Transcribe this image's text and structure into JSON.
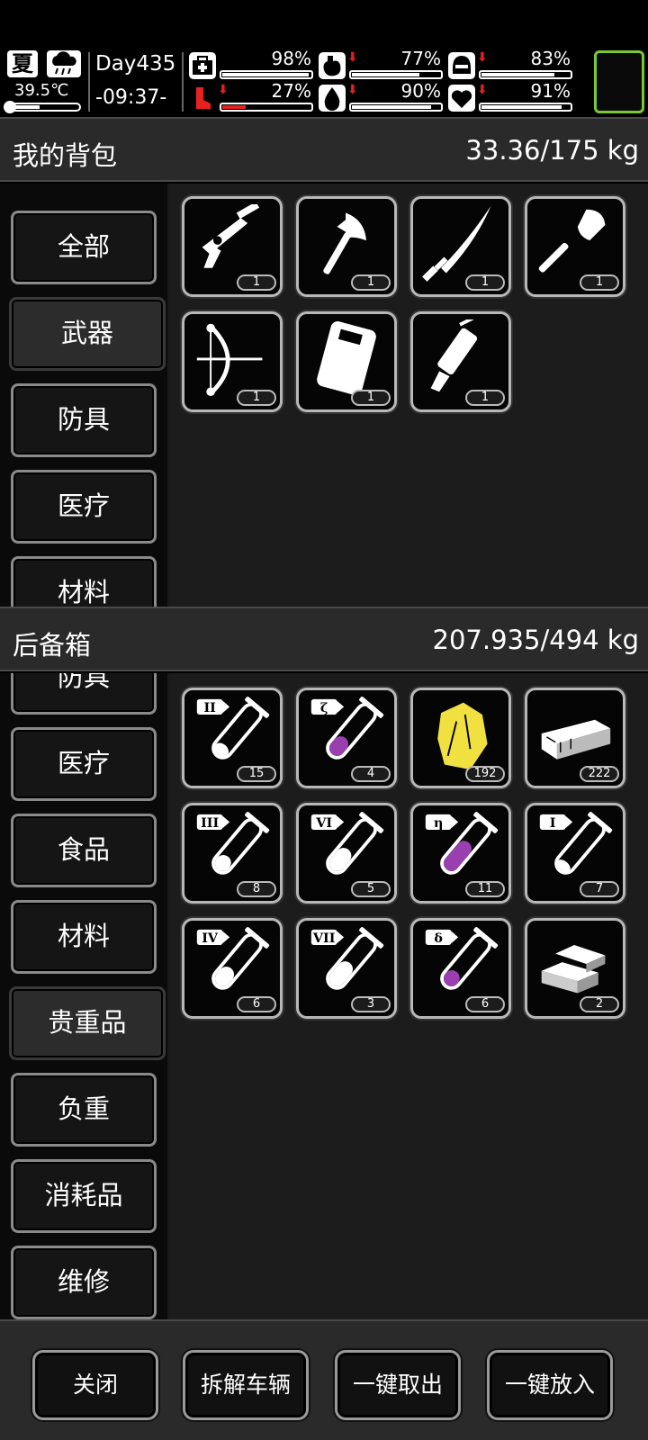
{
  "hud": {
    "season": "夏",
    "temperature": "39.5℃",
    "temperature_level": 0.45,
    "day": "Day435",
    "time": "-09:37-",
    "stats": [
      {
        "name": "health",
        "icon": "medkit-icon",
        "value": "98%",
        "level": 0.98,
        "arrow": false
      },
      {
        "name": "hunger",
        "icon": "stomach-icon",
        "value": "77%",
        "level": 0.77,
        "arrow": true
      },
      {
        "name": "armor",
        "icon": "helmet-icon",
        "value": "83%",
        "level": 0.83,
        "arrow": true
      },
      {
        "name": "stamina",
        "icon": "leg-icon",
        "value": "27%",
        "level": 0.27,
        "arrow": true,
        "color": "#e82020"
      },
      {
        "name": "thirst",
        "icon": "water-drop-icon",
        "value": "90%",
        "level": 0.9,
        "arrow": true
      },
      {
        "name": "mood",
        "icon": "heart-icon",
        "value": "91%",
        "level": 0.91,
        "arrow": true
      }
    ]
  },
  "backpack": {
    "title": "我的背包",
    "weight": "33.36/175 kg",
    "categories": [
      "全部",
      "武器",
      "防具",
      "医疗",
      "材料"
    ],
    "active_category": "武器",
    "items": [
      {
        "icon": "nail-gun-icon",
        "count": "1"
      },
      {
        "icon": "axe-icon",
        "count": "1"
      },
      {
        "icon": "katana-icon",
        "count": "1"
      },
      {
        "icon": "shovel-icon",
        "count": "1"
      },
      {
        "icon": "compound-bow-icon",
        "count": "1"
      },
      {
        "icon": "riot-shield-icon",
        "count": "1"
      },
      {
        "icon": "minigun-icon",
        "count": "1"
      }
    ]
  },
  "trunk": {
    "title": "后备箱",
    "weight": "207.935/494 kg",
    "categories": [
      "防具",
      "医疗",
      "食品",
      "材料",
      "贵重品",
      "负重",
      "消耗品",
      "维修"
    ],
    "active_category": "贵重品",
    "items": [
      {
        "icon": "test-tube-icon",
        "label": "II",
        "count": "15",
        "liquid": "#ffffff",
        "fill": 0.25
      },
      {
        "icon": "test-tube-icon",
        "label": "ζ",
        "count": "4",
        "liquid": "#9a3fb0",
        "fill": 0.45
      },
      {
        "icon": "gold-nugget-icon",
        "count": "192",
        "color": "#f0e040"
      },
      {
        "icon": "cash-stack-icon",
        "count": "222"
      },
      {
        "icon": "test-tube-icon",
        "label": "III",
        "count": "8",
        "liquid": "#ffffff",
        "fill": 0.35
      },
      {
        "icon": "test-tube-icon",
        "label": "VI",
        "count": "5",
        "liquid": "#ffffff",
        "fill": 0.55
      },
      {
        "icon": "test-tube-icon",
        "label": "η",
        "count": "11",
        "liquid": "#9a3fb0",
        "fill": 0.75
      },
      {
        "icon": "test-tube-icon",
        "label": "I",
        "count": "7",
        "liquid": "#ffffff",
        "fill": 0.2
      },
      {
        "icon": "test-tube-icon",
        "label": "IV",
        "count": "6",
        "liquid": "#ffffff",
        "fill": 0.45
      },
      {
        "icon": "test-tube-icon",
        "label": "VII",
        "count": "3",
        "liquid": "#ffffff",
        "fill": 0.6
      },
      {
        "icon": "test-tube-icon",
        "label": "δ",
        "count": "6",
        "liquid": "#9a3fb0",
        "fill": 0.35
      },
      {
        "icon": "gold-bars-icon",
        "count": "2"
      }
    ]
  },
  "actions": {
    "close": "关闭",
    "dismantle": "拆解车辆",
    "take_all": "一键取出",
    "put_all": "一键放入"
  },
  "colors": {
    "accent_green": "#7cc832",
    "alert_red": "#e82020",
    "potion_purple": "#9a3fb0",
    "gold": "#f0e040"
  }
}
